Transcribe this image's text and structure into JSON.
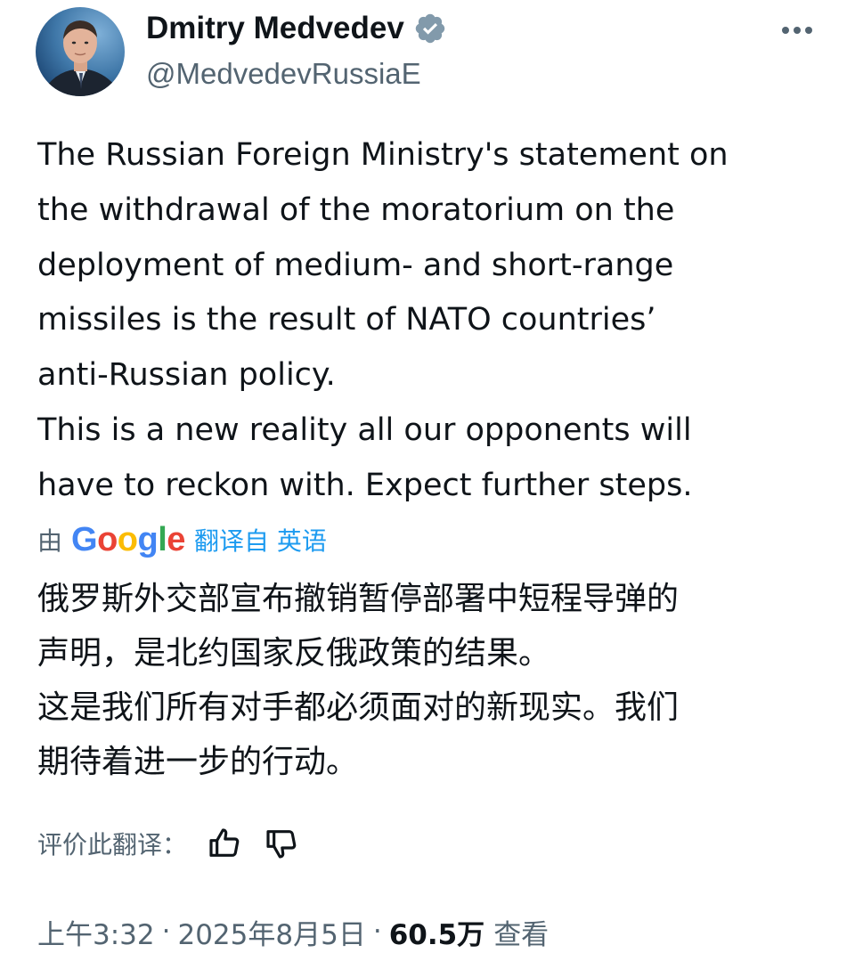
{
  "author": {
    "display_name": "Dmitry Medvedev",
    "handle": "@MedvedevRussiaE",
    "verified_icon": "verified-badge-icon",
    "avatar_icon": "profile-photo"
  },
  "menu": {
    "more_icon": "more-horizontal-icon"
  },
  "tweet": {
    "text_lines": [
      "The Russian Foreign Ministry's statement on",
      "the withdrawal of the moratorium on the",
      "deployment of medium- and short-range",
      "missiles is the result of NATO countries’",
      "anti-Russian policy.",
      "This is a new reality all our opponents will",
      "have to reckon with. Expect further steps."
    ]
  },
  "translation": {
    "by_label": "由",
    "provider": "Google",
    "translated_from": "翻译自 英语",
    "text_lines": [
      "俄罗斯外交部宣布撤销暂停部署中短程导弹的",
      "声明，是北约国家反俄政策的结果。",
      "这是我们所有对手都必须面对的新现实。我们",
      "期待着进一步的行动。"
    ],
    "rate_label": "评价此翻译：",
    "thumbs_up_icon": "thumbs-up-icon",
    "thumbs_down_icon": "thumbs-down-icon"
  },
  "meta": {
    "time": "上午3:32",
    "separator": "·",
    "date": "2025年8月5日",
    "views_count": "60.5万",
    "views_label": "查看"
  },
  "colors": {
    "text_primary": "#0f1419",
    "text_secondary": "#536471",
    "link_blue": "#1d9bf0",
    "google_blue": "#4285F4",
    "google_red": "#EA4335",
    "google_yellow": "#FBBC05",
    "google_green": "#34A853"
  }
}
